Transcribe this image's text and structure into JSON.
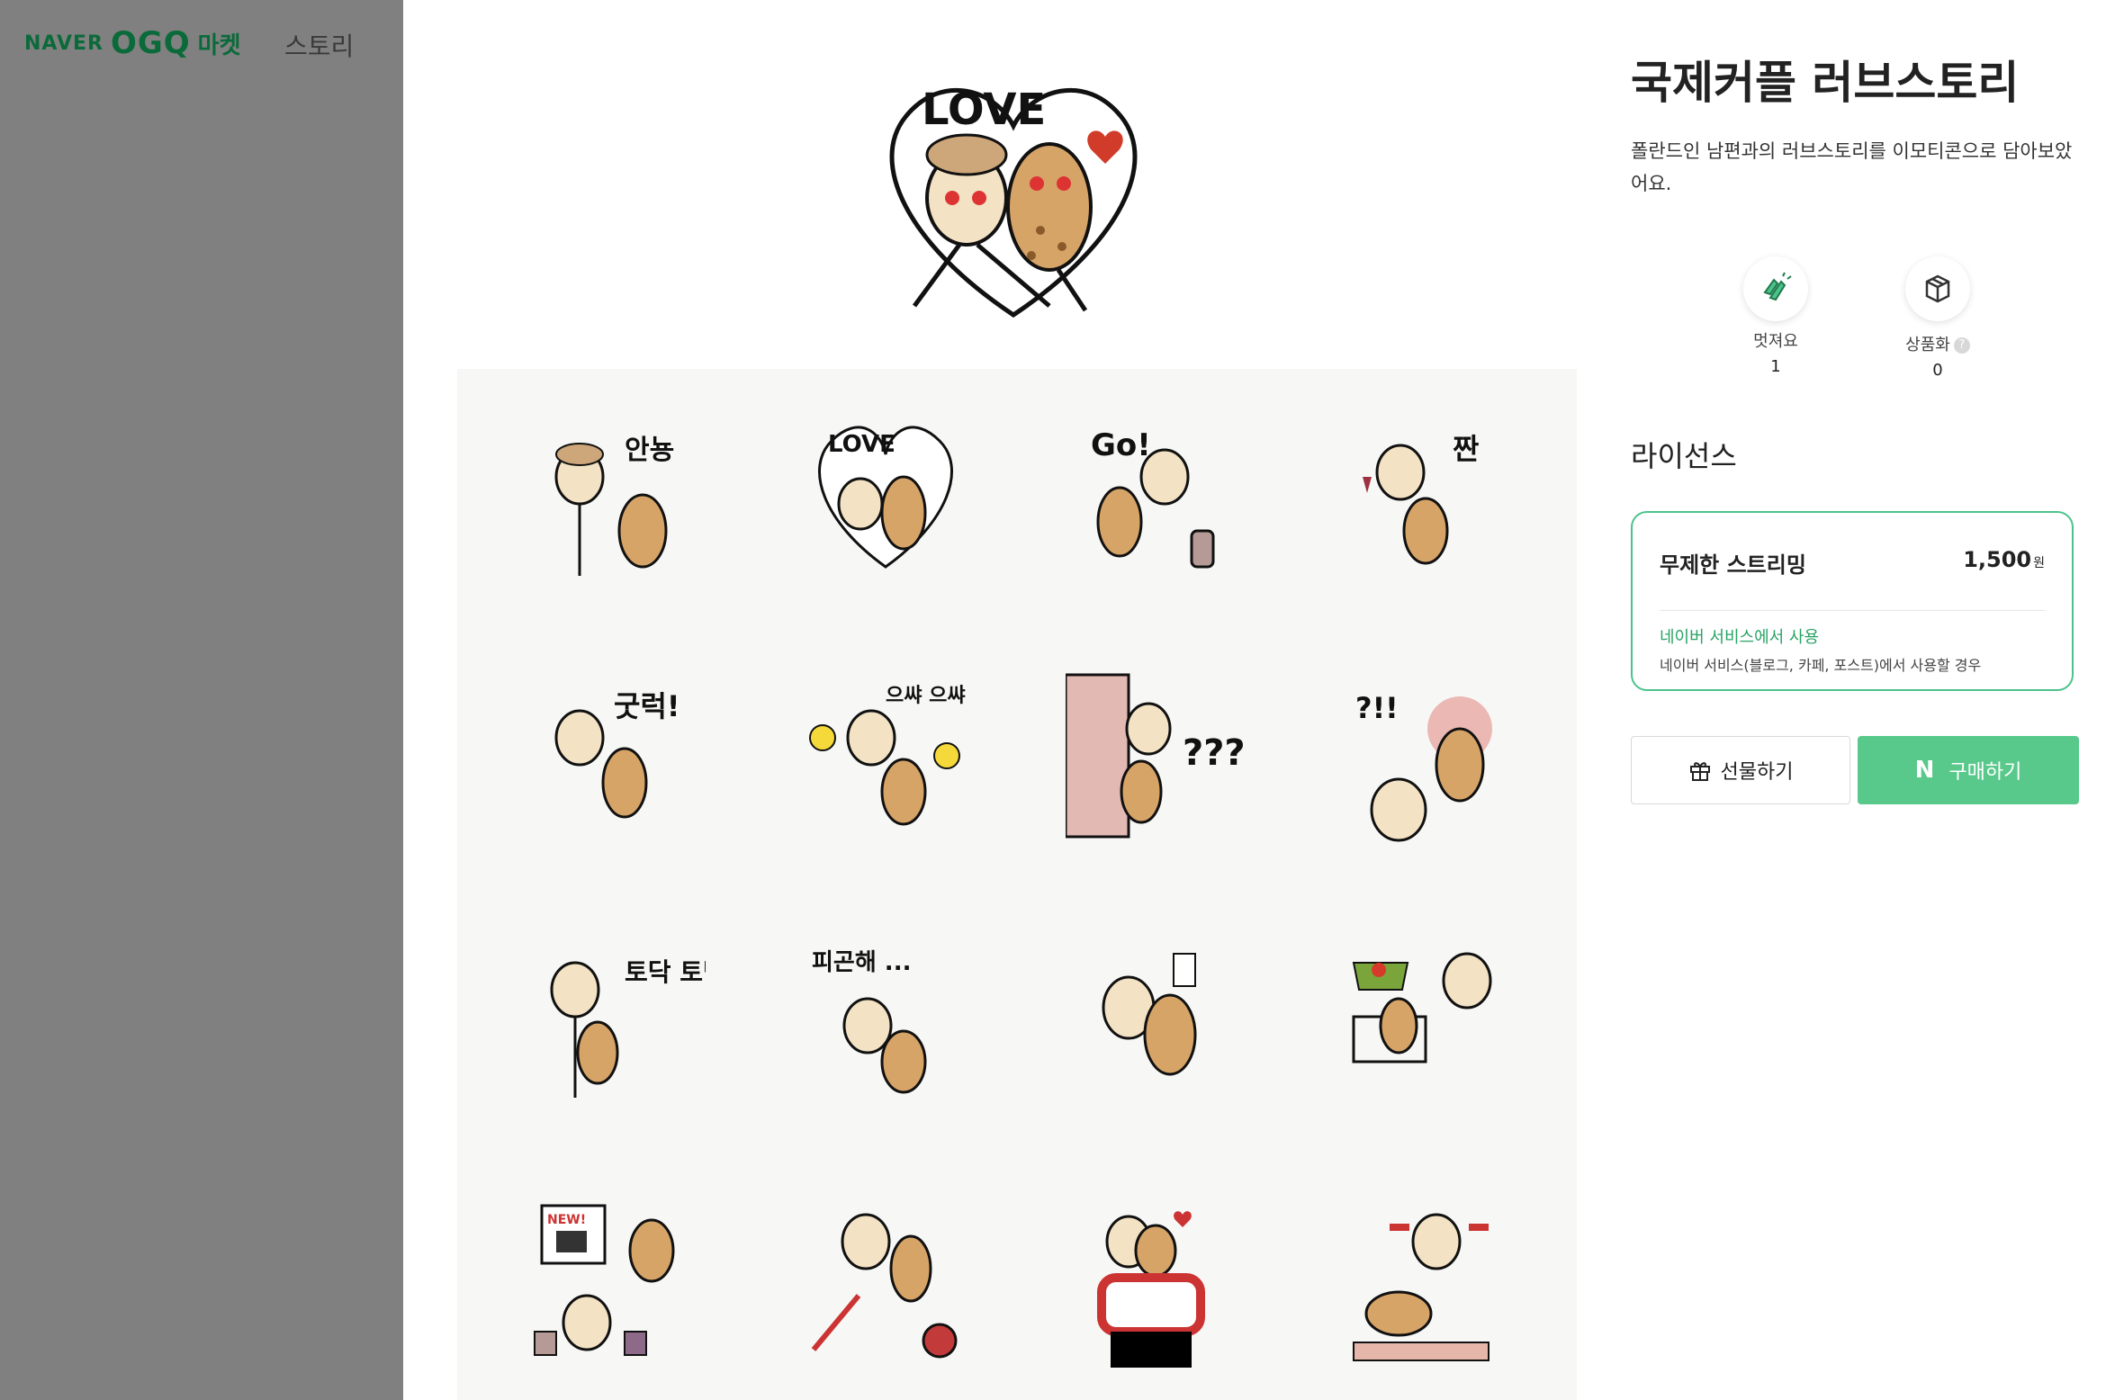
{
  "header": {
    "logo_naver": "NAVER",
    "logo_ogq": "OGQ",
    "logo_market": "마켓",
    "nav_story": "스토리"
  },
  "product": {
    "title": "국제커플 러브스토리",
    "description": "폴란드인 남편과의 러브스토리를 이모티콘으로 담아보았어요.",
    "main_sticker_text": "LOVE"
  },
  "stats": {
    "likes_label": "멋져요",
    "likes_value": "1",
    "goods_label": "상품화",
    "goods_value": "0",
    "help_glyph": "?"
  },
  "license": {
    "heading": "라이선스",
    "option_name": "무제한 스트리밍",
    "price": "1,500",
    "price_unit": "원",
    "usage_title": "네이버 서비스에서 사용",
    "usage_desc": "네이버 서비스(블로그, 카페, 포스트)에서 사용할 경우"
  },
  "actions": {
    "gift_label": "선물하기",
    "buy_label": "구매하기",
    "buy_mark": "N"
  },
  "stickers": [
    {
      "text": "안뇽"
    },
    {
      "text": "LOVE"
    },
    {
      "text": "Go!"
    },
    {
      "text": "짠"
    },
    {
      "text": "굿럭!"
    },
    {
      "text": "으쌰 으쌰"
    },
    {
      "text": "???"
    },
    {
      "text": "?!!"
    },
    {
      "text": "토닥 토닥"
    },
    {
      "text": "피곤해 ..."
    },
    {
      "text": ""
    },
    {
      "text": ""
    },
    {
      "text": "NEW!"
    },
    {
      "text": ""
    },
    {
      "text": ""
    },
    {
      "text": ""
    }
  ],
  "colors": {
    "brand_green": "#58c98b",
    "logo_green": "#0b6a3a",
    "usage_green": "#27a363"
  }
}
